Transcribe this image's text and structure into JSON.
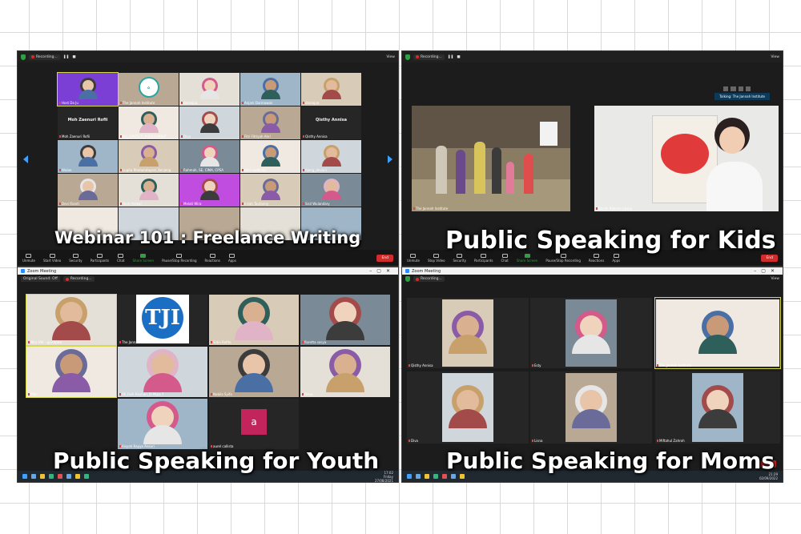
{
  "captions": {
    "p1": "Webinar 101 : Freelance Writing",
    "p2": "Public Speaking for Kids",
    "p3": "Public Speaking for Youth",
    "p4": "Public Speaking for Moms"
  },
  "zoom": {
    "recording_label": "Recording...",
    "view_label": "View",
    "window_title": "Zoom Meeting",
    "original_sound": "Original Sound: Off",
    "end_label": "End",
    "talking_label": "Talking: The Jannah Institute",
    "logo_text": "The Jannah Institute",
    "tji_logo_text": "TJI",
    "controls": [
      "Unmute",
      "Start Video",
      "Security",
      "Participants",
      "Chat",
      "Share Screen",
      "Pause/Stop Recording",
      "Reactions",
      "Apps"
    ],
    "controls_p2": [
      "Unmute",
      "Stop Video",
      "Security",
      "Participants",
      "Chat",
      "Share Screen",
      "Pause/Stop Recording",
      "Reactions",
      "Apps"
    ]
  },
  "panel1": {
    "page_left": "1/2",
    "page_right": "1/2",
    "tiles": [
      {
        "name": "Host Da Ju",
        "text": ""
      },
      {
        "name": "The Jannah Institute",
        "text": ""
      },
      {
        "name": "daniajua",
        "text": ""
      },
      {
        "name": "Anjani Darmawan",
        "text": ""
      },
      {
        "name": "daniajua",
        "text": ""
      },
      {
        "name": "Moh Zaenuri Rofii",
        "text": "Moh Zaenuri Rofii"
      },
      {
        "name": "BLJ_LIASTUTI_POERSAMBAT",
        "text": ""
      },
      {
        "name": "Diva",
        "text": ""
      },
      {
        "name": "Fitri Fitriyah Ahri",
        "text": ""
      },
      {
        "name": "Qisthy Annisa",
        "text": "Qisthy Annisa"
      },
      {
        "name": "Wulan",
        "text": ""
      },
      {
        "name": "Lugita Rhohandayani_Kenjeng",
        "text": ""
      },
      {
        "name": "Rahmah, SE, CIMA, CPSA",
        "text": ""
      },
      {
        "name": "Umi nadhiroh",
        "text": ""
      },
      {
        "name": "Ajeng_devani",
        "text": ""
      },
      {
        "name": "Devi Rianti",
        "text": ""
      },
      {
        "name": "Yardi Ambar",
        "text": ""
      },
      {
        "name": "Melati Wira",
        "text": ""
      },
      {
        "name": "Inilah Taufanny",
        "text": ""
      },
      {
        "name": "Sisil Wulandary",
        "text": ""
      },
      {
        "name": "",
        "text": ""
      },
      {
        "name": "",
        "text": ""
      },
      {
        "name": "",
        "text": ""
      },
      {
        "name": "",
        "text": ""
      },
      {
        "name": "",
        "text": ""
      }
    ]
  },
  "panel2": {
    "tiles": [
      {
        "name": "The Jannah Institute"
      },
      {
        "name": "Bocah Nilasari Lanny"
      }
    ]
  },
  "panel3": {
    "clock_time": "17:02",
    "clock_day": "Friday",
    "clock_date": "27/08/2021",
    "tiles": [
      {
        "name": "Nita HW - @aritpkw"
      },
      {
        "name": "The Jannah Institute"
      },
      {
        "name": "Sidia Rofita"
      },
      {
        "name": "fioretta sasya"
      },
      {
        "name": "Iffat"
      },
      {
        "name": "06_Fath Reyhan_XI Mipa 7"
      },
      {
        "name": "Nabila Syifa"
      },
      {
        "name": "Dena"
      },
      {
        "name": "Aisyah Rayya Ansari"
      },
      {
        "name": "aurel callista"
      }
    ],
    "avatar_letter": "a"
  },
  "panel4": {
    "clock_time": "21:29",
    "clock_date": "02/09/2022",
    "tiles": [
      {
        "name": "Qisthy Annisa"
      },
      {
        "name": "Esty"
      },
      {
        "name": "The Jannah Institute"
      },
      {
        "name": "Diva"
      },
      {
        "name": "Lisna"
      },
      {
        "name": ""
      },
      {
        "name": "Miftahul Zahroh"
      }
    ]
  },
  "colors": {
    "zoom_bg": "#1c1c1c",
    "end_red": "#d12b2b",
    "share_green": "#2ea043",
    "active_speaker": "#d6d84a",
    "tji_blue": "#1a6fc4",
    "avatar_pink": "#c2245b"
  }
}
